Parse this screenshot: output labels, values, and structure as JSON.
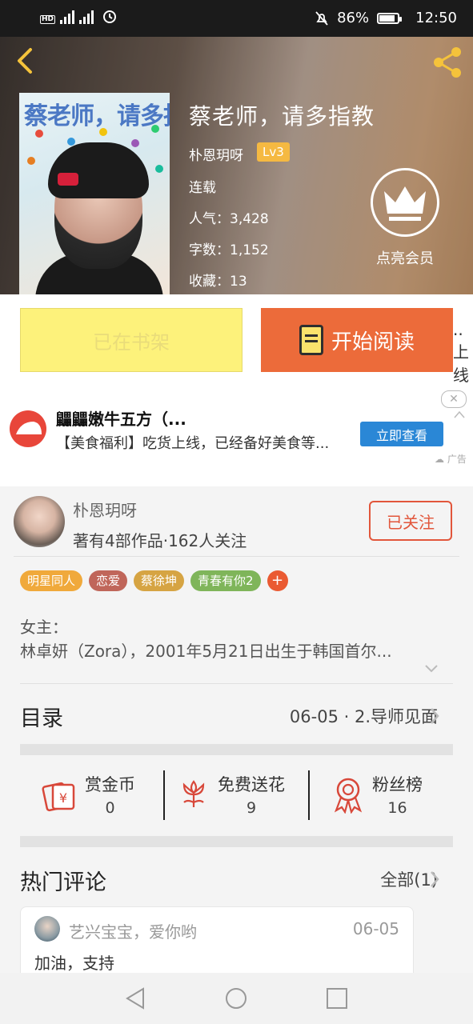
{
  "status_bar": {
    "battery_percent": "86%",
    "time": "12:50",
    "battery_level": 0.86
  },
  "book": {
    "cover_title": "蔡老师，请多指教",
    "title": "蔡老师，请多指教",
    "author": "朴恩玥呀",
    "level": "Lv3",
    "status": "连载",
    "popularity": "人气：3,428",
    "word_count": "字数：1,152",
    "favorites": "收藏：13"
  },
  "vip": {
    "label": "点亮会员"
  },
  "actions": {
    "shelf_label": "已在书架",
    "read_label": "开始阅读",
    "edge_top": "..",
    "edge_bottom": "上线"
  },
  "ad": {
    "title": "鼺鼺嫩牛五方（...",
    "subtitle": "【美食福利】吃货上线，已经备好美食等...",
    "button": "立即查看",
    "close": "✕",
    "tag": "广告"
  },
  "author_card": {
    "name": "朴恩玥呀",
    "stats": "著有4部作品·162人关注",
    "follow_label": "已关注"
  },
  "tags": [
    {
      "label": "明星同人",
      "color": "#f0a93b"
    },
    {
      "label": "恋爱",
      "color": "#c0665a"
    },
    {
      "label": "蔡徐坤",
      "color": "#d6a443"
    },
    {
      "label": "青春有你2",
      "color": "#7fb55a"
    }
  ],
  "description": {
    "line1": "女主：",
    "line2": "林卓妍（Zora），2001年5月21日出生于韩国首尔..."
  },
  "toc": {
    "label": "目录",
    "latest": "06-05 · 2.导师见面"
  },
  "stats": [
    {
      "label": "赏金币",
      "value": "0",
      "icon": "money-envelope-icon"
    },
    {
      "label": "免费送花",
      "value": "9",
      "icon": "flower-icon"
    },
    {
      "label": "粉丝榜",
      "value": "16",
      "icon": "award-ribbon-icon"
    }
  ],
  "comments_section": {
    "label": "热门评论",
    "all": "全部(1)"
  },
  "comment": {
    "user": "艺兴宝宝，爱你哟",
    "date": "06-05",
    "text": "加油，支持"
  },
  "colors": {
    "accent": "#ec6b3a",
    "follow": "#e2563b",
    "shelf": "#fdf27b",
    "ad_button": "#2a87d6"
  }
}
